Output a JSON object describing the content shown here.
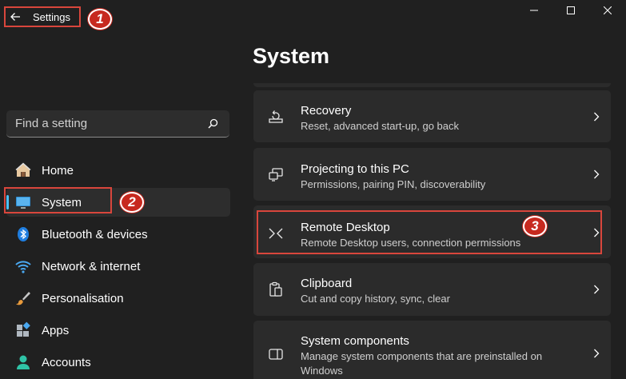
{
  "window": {
    "title": "Settings"
  },
  "markers": [
    "1",
    "2",
    "3"
  ],
  "search": {
    "placeholder": "Find a setting"
  },
  "sidebar": {
    "items": [
      {
        "label": "Home",
        "icon": "home-icon"
      },
      {
        "label": "System",
        "icon": "monitor-icon",
        "active": true
      },
      {
        "label": "Bluetooth & devices",
        "icon": "bluetooth-icon"
      },
      {
        "label": "Network & internet",
        "icon": "wifi-icon"
      },
      {
        "label": "Personalisation",
        "icon": "brush-icon"
      },
      {
        "label": "Apps",
        "icon": "apps-icon"
      },
      {
        "label": "Accounts",
        "icon": "person-icon"
      }
    ]
  },
  "main": {
    "title": "System",
    "cards": [
      {
        "title": "Recovery",
        "subtitle": "Reset, advanced start-up, go back",
        "icon": "recovery-icon"
      },
      {
        "title": "Projecting to this PC",
        "subtitle": "Permissions, pairing PIN, discoverability",
        "icon": "projecting-icon"
      },
      {
        "title": "Remote Desktop",
        "subtitle": "Remote Desktop users, connection permissions",
        "icon": "remote-desktop-icon"
      },
      {
        "title": "Clipboard",
        "subtitle": "Cut and copy history, sync, clear",
        "icon": "clipboard-icon"
      },
      {
        "title": "System components",
        "subtitle": "Manage system components that are preinstalled on Windows",
        "icon": "components-icon"
      }
    ]
  },
  "colors": {
    "background": "#202020",
    "card": "#2b2b2b",
    "accent": "#4cc2ff",
    "annotation": "#d9463c"
  }
}
